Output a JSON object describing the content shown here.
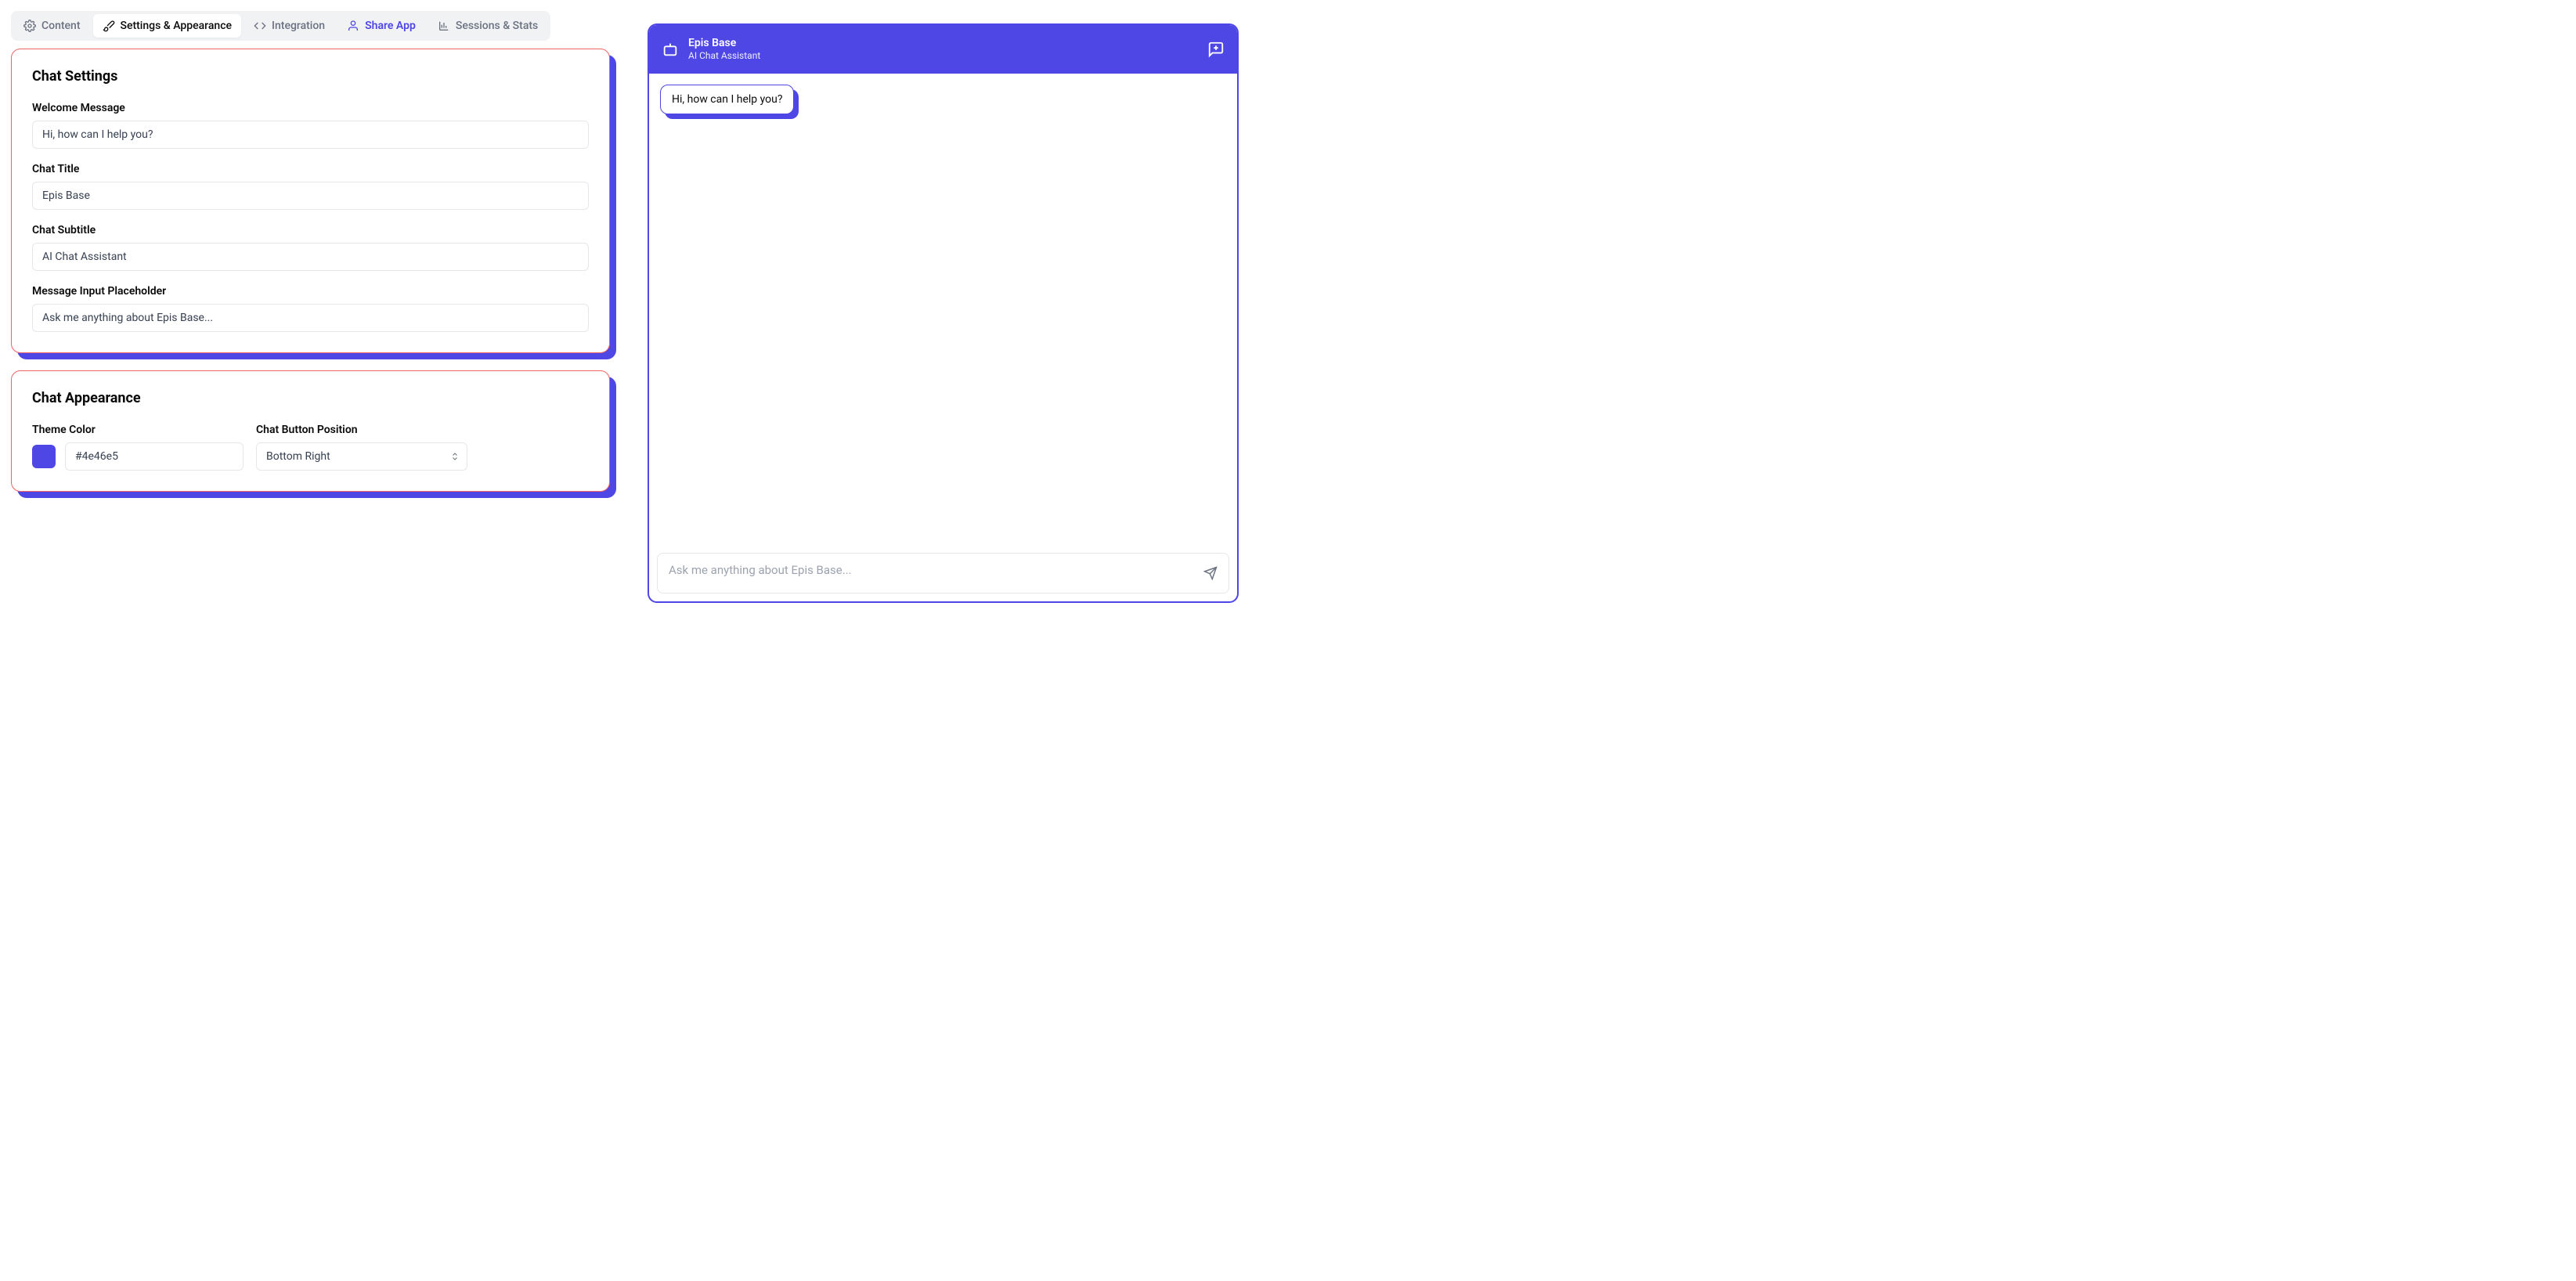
{
  "tabs": {
    "content": "Content",
    "settings": "Settings & Appearance",
    "integration": "Integration",
    "share": "Share App",
    "sessions": "Sessions & Stats"
  },
  "cards": {
    "chat_settings": {
      "title": "Chat Settings",
      "welcome_label": "Welcome Message",
      "welcome_value": "Hi, how can I help you?",
      "title_label": "Chat Title",
      "title_value": "Epis Base",
      "subtitle_label": "Chat Subtitle",
      "subtitle_value": "AI Chat Assistant",
      "placeholder_label": "Message Input Placeholder",
      "placeholder_value": "Ask me anything about Epis Base..."
    },
    "appearance": {
      "title": "Chat Appearance",
      "theme_color_label": "Theme Color",
      "theme_color_value": "#4e46e5",
      "position_label": "Chat Button Position",
      "position_value": "Bottom Right"
    }
  },
  "preview": {
    "header_title": "Epis Base",
    "header_subtitle": "AI Chat Assistant",
    "welcome_bubble": "Hi, how can I help you?",
    "input_placeholder": "Ask me anything about Epis Base..."
  },
  "colors": {
    "theme": "#4e46e5"
  }
}
